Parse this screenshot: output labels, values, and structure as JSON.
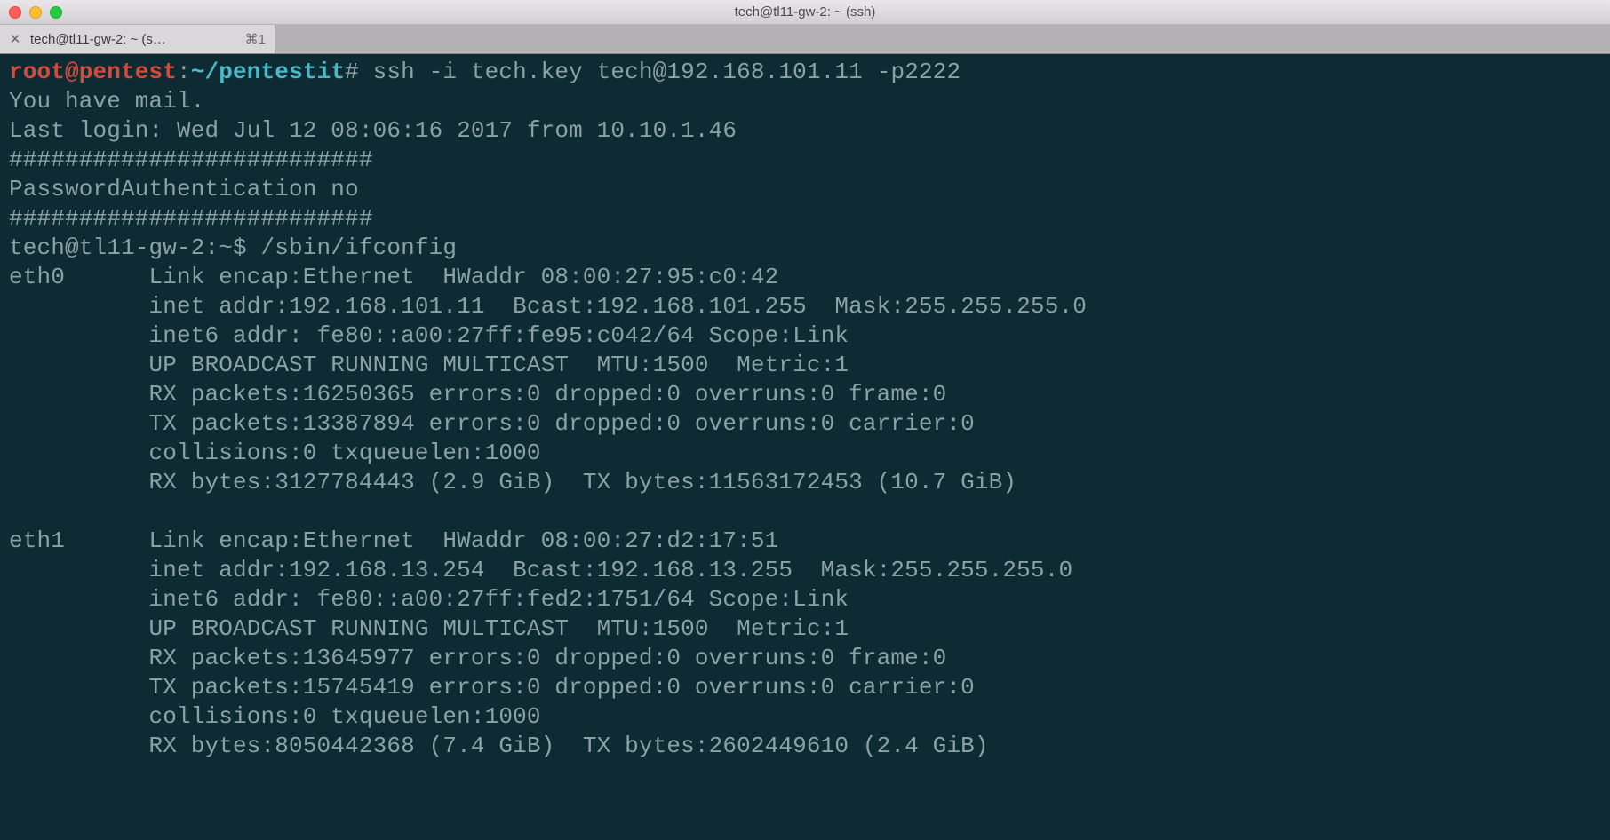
{
  "window": {
    "title": "tech@tl11-gw-2: ~ (ssh)"
  },
  "tab": {
    "label": "tech@tl11-gw-2: ~ (s…",
    "shortcut": "⌘1"
  },
  "prompt1": {
    "user": "root@pentest",
    "sep": ":",
    "path": "~/pentestit",
    "hash": "#",
    "cmd": " ssh -i tech.key tech@192.168.101.11 -p2222"
  },
  "lines": {
    "l1": "You have mail.",
    "l2": "Last login: Wed Jul 12 08:06:16 2017 from 10.10.1.46",
    "l3": "##########################",
    "l4": "PasswordAuthentication no",
    "l5": "##########################",
    "l6": "tech@tl11-gw-2:~$ /sbin/ifconfig",
    "l7": "eth0      Link encap:Ethernet  HWaddr 08:00:27:95:c0:42",
    "l8": "          inet addr:192.168.101.11  Bcast:192.168.101.255  Mask:255.255.255.0",
    "l9": "          inet6 addr: fe80::a00:27ff:fe95:c042/64 Scope:Link",
    "l10": "          UP BROADCAST RUNNING MULTICAST  MTU:1500  Metric:1",
    "l11": "          RX packets:16250365 errors:0 dropped:0 overruns:0 frame:0",
    "l12": "          TX packets:13387894 errors:0 dropped:0 overruns:0 carrier:0",
    "l13": "          collisions:0 txqueuelen:1000",
    "l14": "          RX bytes:3127784443 (2.9 GiB)  TX bytes:11563172453 (10.7 GiB)",
    "l15": "",
    "l16": "eth1      Link encap:Ethernet  HWaddr 08:00:27:d2:17:51",
    "l17": "          inet addr:192.168.13.254  Bcast:192.168.13.255  Mask:255.255.255.0",
    "l18": "          inet6 addr: fe80::a00:27ff:fed2:1751/64 Scope:Link",
    "l19": "          UP BROADCAST RUNNING MULTICAST  MTU:1500  Metric:1",
    "l20": "          RX packets:13645977 errors:0 dropped:0 overruns:0 frame:0",
    "l21": "          TX packets:15745419 errors:0 dropped:0 overruns:0 carrier:0",
    "l22": "          collisions:0 txqueuelen:1000",
    "l23": "          RX bytes:8050442368 (7.4 GiB)  TX bytes:2602449610 (2.4 GiB)"
  }
}
